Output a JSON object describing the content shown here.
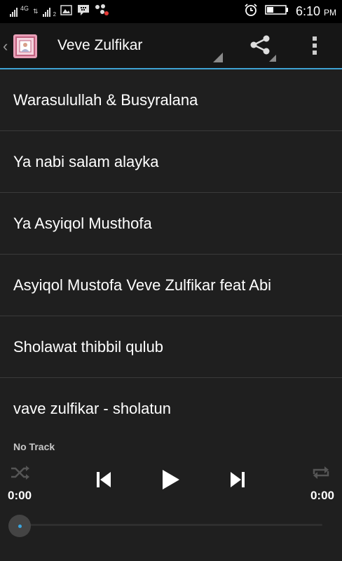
{
  "status_bar": {
    "network_type": "4G",
    "sim2_label": "2",
    "time": "6:10",
    "ampm": "PM"
  },
  "action_bar": {
    "title": "Veve Zulfikar",
    "accent_color": "#3fa3d3"
  },
  "songs": [
    {
      "title": "Warasulullah & Busyralana"
    },
    {
      "title": "Ya nabi salam alayka"
    },
    {
      "title": "Ya Asyiqol Musthofa"
    },
    {
      "title": "Asyiqol Mustofa Veve Zulfikar feat Abi"
    },
    {
      "title": "Sholawat thibbil qulub"
    },
    {
      "title": "vave zulfikar - sholatun"
    }
  ],
  "player": {
    "track_name": "No Track",
    "current_time": "0:00",
    "duration": "0:00",
    "progress": 0,
    "icons": [
      "shuffle-icon",
      "previous-icon",
      "play-icon",
      "next-icon",
      "repeat-icon"
    ]
  }
}
